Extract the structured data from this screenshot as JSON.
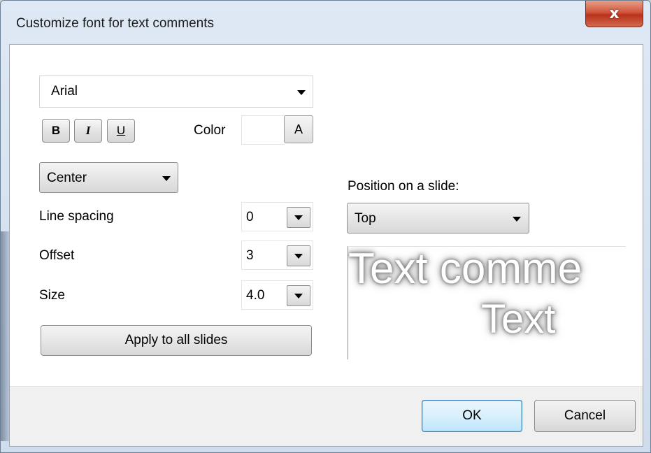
{
  "window": {
    "title": "Customize font for text comments",
    "close_glyph": "x"
  },
  "font": {
    "family": "Arial",
    "bold_label": "B",
    "italic_label": "I",
    "underline_label": "U",
    "color_label": "Color",
    "color_button_label": "A"
  },
  "alignment": {
    "value": "Center"
  },
  "fields": {
    "line_spacing": {
      "label": "Line spacing",
      "value": "0"
    },
    "offset": {
      "label": "Offset",
      "value": "3"
    },
    "size": {
      "label": "Size",
      "value": "4.0"
    }
  },
  "apply_label": "Apply to all slides",
  "position": {
    "label": "Position on a slide:",
    "value": "Top"
  },
  "preview": {
    "line1": "Text comme",
    "line2": "Text"
  },
  "buttons": {
    "ok": "OK",
    "cancel": "Cancel"
  }
}
